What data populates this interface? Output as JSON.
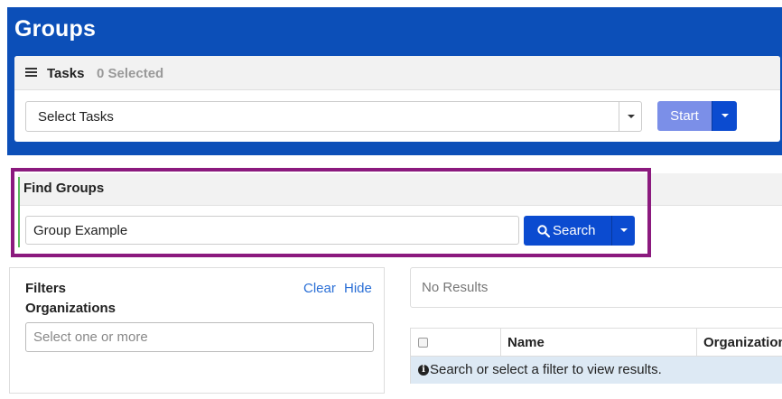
{
  "header": {
    "title": "Groups",
    "background": "#0c4fb8"
  },
  "tasks": {
    "label": "Tasks",
    "selected_count": "0 Selected",
    "icon": "list-icon",
    "select_value": "Select Tasks",
    "start_label": "Start"
  },
  "find_groups": {
    "title": "Find Groups",
    "query": "Group Example",
    "search_label": "Search",
    "search_icon": "magnifier-icon",
    "highlight_color": "#8b1a7e"
  },
  "filters": {
    "title": "Filters",
    "clear_label": "Clear",
    "hide_label": "Hide",
    "organizations_label": "Organizations",
    "organizations_placeholder": "Select one or more"
  },
  "results": {
    "summary": "No Results",
    "columns": [
      "Name",
      "Organization"
    ],
    "empty_message": "Search or select a filter to view results.",
    "info_icon": "info-circle-icon"
  },
  "colors": {
    "primary_button": "#0b4bd0",
    "start_button": "#7b8fe8",
    "link": "#2a6fd6",
    "info_row": "#dde9f4"
  }
}
